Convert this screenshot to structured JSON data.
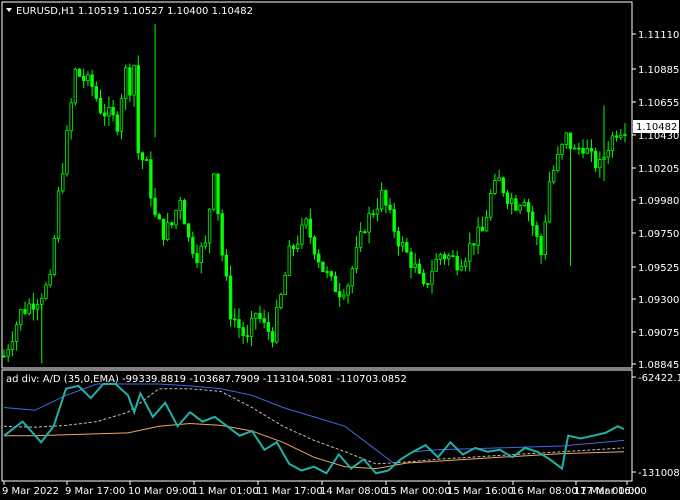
{
  "main_header": {
    "symbol": "EURUSD,H1",
    "ohlc": "1.10519 1.10527 1.10400 1.10482"
  },
  "price_axis": {
    "ticks": [
      "1.11110",
      "1.10885",
      "1.10655",
      "1.10430",
      "1.10205",
      "1.09980",
      "1.09750",
      "1.09525",
      "1.09300",
      "1.09075",
      "1.08845"
    ],
    "current_price": "1.10482"
  },
  "indicator_header": {
    "text": "ad div: A/D (35,0,EMA) -99339.8819 -103687.7909 -113104.5081 -110703.0852"
  },
  "indicator_axis": {
    "top": "-62422.12",
    "bottom": "-131008.9"
  },
  "time_axis": {
    "labels": [
      "9 Mar 2022",
      "9 Mar 17:00",
      "10 Mar 09:00",
      "11 Mar 01:00",
      "11 Mar 17:00",
      "14 Mar 08:00",
      "15 Mar 00:00",
      "15 Mar 16:00",
      "16 Mar 08:00",
      "17 Mar 00:00",
      "17 Mar 16:00"
    ]
  },
  "colors": {
    "background": "#000000",
    "frame": "#ffffff",
    "candle": "#00ff00",
    "ad_line": "#20b2aa",
    "slow_line": "#4169e1",
    "fast_line": "#f4a460",
    "dashed_line": "#c0c0c0",
    "price_box_bg": "#ffffff",
    "price_box_fg": "#000000"
  },
  "chart_data": {
    "type": "candlestick",
    "symbol": "EURUSD",
    "timeframe": "H1",
    "close_path": [
      [
        0,
        1.089
      ],
      [
        4,
        1.092
      ],
      [
        8,
        1.093
      ],
      [
        11,
        1.094
      ],
      [
        13,
        1.1
      ],
      [
        15,
        1.104
      ],
      [
        17,
        1.1085
      ],
      [
        19,
        1.108
      ],
      [
        21,
        1.1075
      ],
      [
        23,
        1.106
      ],
      [
        25,
        1.1055
      ],
      [
        27,
        1.105
      ],
      [
        28,
        1.107
      ],
      [
        29,
        1.1085
      ],
      [
        30,
        1.1075
      ],
      [
        31,
        1.109
      ],
      [
        32,
        1.103
      ],
      [
        34,
        1.102
      ],
      [
        36,
        1.0985
      ],
      [
        38,
        1.0975
      ],
      [
        40,
        1.098
      ],
      [
        42,
        1.1
      ],
      [
        44,
        1.097
      ],
      [
        46,
        1.096
      ],
      [
        48,
        1.0965
      ],
      [
        50,
        1.102
      ],
      [
        52,
        1.096
      ],
      [
        54,
        1.092
      ],
      [
        56,
        1.091
      ],
      [
        58,
        1.09
      ],
      [
        60,
        1.092
      ],
      [
        62,
        1.091
      ],
      [
        64,
        1.0905
      ],
      [
        66,
        1.093
      ],
      [
        68,
        1.096
      ],
      [
        70,
        1.097
      ],
      [
        72,
        1.098
      ],
      [
        74,
        1.0965
      ],
      [
        76,
        1.095
      ],
      [
        78,
        1.094
      ],
      [
        80,
        1.0935
      ],
      [
        82,
        1.094
      ],
      [
        84,
        1.096
      ],
      [
        86,
        1.098
      ],
      [
        88,
        1.099
      ],
      [
        90,
        1.1
      ],
      [
        92,
        1.0985
      ],
      [
        94,
        1.097
      ],
      [
        96,
        1.096
      ],
      [
        98,
        1.095
      ],
      [
        100,
        1.0935
      ],
      [
        102,
        1.095
      ],
      [
        104,
        1.096
      ],
      [
        106,
        1.0958
      ],
      [
        108,
        1.0955
      ],
      [
        110,
        1.096
      ],
      [
        112,
        1.097
      ],
      [
        114,
        1.0975
      ],
      [
        116,
        1.1
      ],
      [
        118,
        1.101
      ],
      [
        120,
        1.1
      ],
      [
        122,
        1.0995
      ],
      [
        124,
        1.1
      ],
      [
        126,
        1.098
      ],
      [
        128,
        1.096
      ],
      [
        130,
        1.101
      ],
      [
        132,
        1.1025
      ],
      [
        134,
        1.104
      ],
      [
        136,
        1.103
      ],
      [
        138,
        1.1035
      ],
      [
        140,
        1.1025
      ],
      [
        142,
        1.102
      ],
      [
        144,
        1.1035
      ],
      [
        146,
        1.1045
      ],
      [
        148,
        1.1048
      ]
    ]
  }
}
